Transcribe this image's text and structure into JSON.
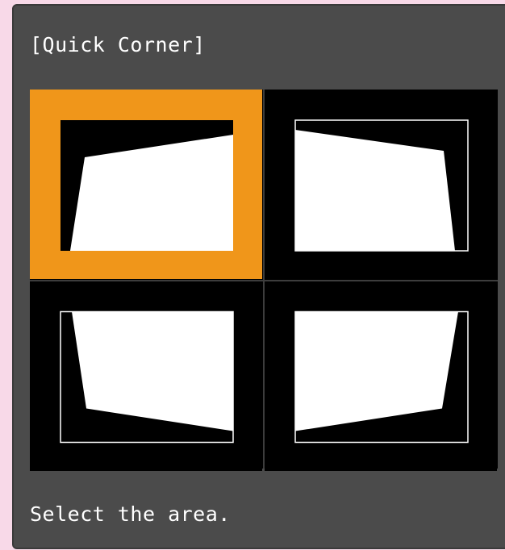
{
  "dialog": {
    "title": "[Quick Corner]",
    "instruction": "Select the area.",
    "selected_area": "top-left",
    "colors": {
      "background": "#4b4b4b",
      "selection": "#f0961a",
      "screen": "#ffffff",
      "frame": "#000000"
    }
  },
  "areas": [
    {
      "id": "top-left",
      "selected": true
    },
    {
      "id": "top-right",
      "selected": false
    },
    {
      "id": "bottom-left",
      "selected": false
    },
    {
      "id": "bottom-right",
      "selected": false
    }
  ]
}
